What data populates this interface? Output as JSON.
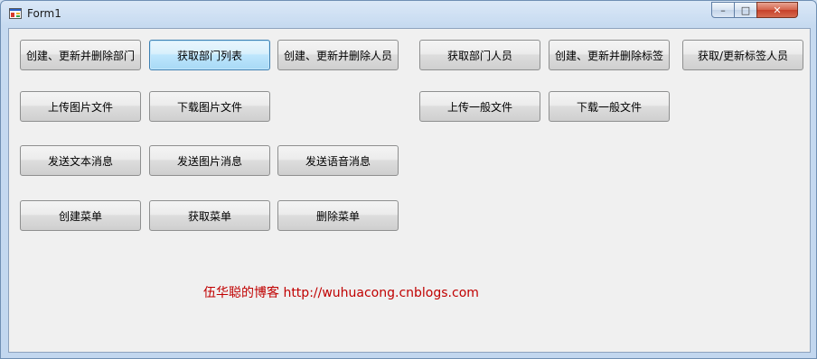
{
  "window": {
    "title": "Form1"
  },
  "caption": {
    "minimize": "–",
    "maximize": "□",
    "close": "✕"
  },
  "buttons": {
    "create_update_delete_dept": "创建、更新并删除部门",
    "get_dept_list": "获取部门列表",
    "create_update_delete_user": "创建、更新并删除人员",
    "get_dept_users": "获取部门人员",
    "create_update_delete_tag": "创建、更新并删除标签",
    "get_update_tag_users": "获取/更新标签人员",
    "upload_image": "上传图片文件",
    "download_image": "下载图片文件",
    "upload_file": "上传一般文件",
    "download_file": "下载一般文件",
    "send_text": "发送文本消息",
    "send_image": "发送图片消息",
    "send_voice": "发送语音消息",
    "create_menu": "创建菜单",
    "get_menu": "获取菜单",
    "delete_menu": "删除菜单"
  },
  "footer": {
    "blog_link": "伍华聪的博客 http://wuhuacong.cnblogs.com"
  }
}
